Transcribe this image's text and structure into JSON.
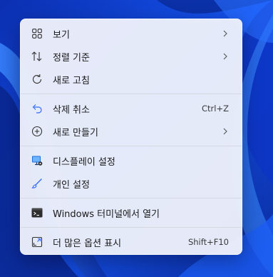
{
  "desktop": {
    "background_color": "#0a3bd6",
    "accent_color": "#2f6bff"
  },
  "context_menu": {
    "groups": [
      {
        "items": [
          {
            "label": "보기",
            "icon": "grid-icon",
            "submenu": true
          },
          {
            "label": "정렬 기준",
            "icon": "sort-icon",
            "submenu": true
          },
          {
            "label": "새로 고침",
            "icon": "refresh-icon",
            "submenu": false
          }
        ]
      },
      {
        "items": [
          {
            "label": "삭제 취소",
            "icon": "undo-icon",
            "shortcut": "Ctrl+Z"
          },
          {
            "label": "새로 만들기",
            "icon": "new-icon",
            "submenu": true
          }
        ]
      },
      {
        "items": [
          {
            "label": "디스플레이 설정",
            "icon": "display-settings-icon"
          },
          {
            "label": "개인 설정",
            "icon": "personalize-icon"
          }
        ]
      },
      {
        "items": [
          {
            "label": "Windows 터미널에서 열기",
            "icon": "terminal-icon"
          }
        ]
      },
      {
        "items": [
          {
            "label": "더 많은 옵션 표시",
            "icon": "more-options-icon",
            "shortcut": "Shift+F10"
          }
        ]
      }
    ]
  }
}
